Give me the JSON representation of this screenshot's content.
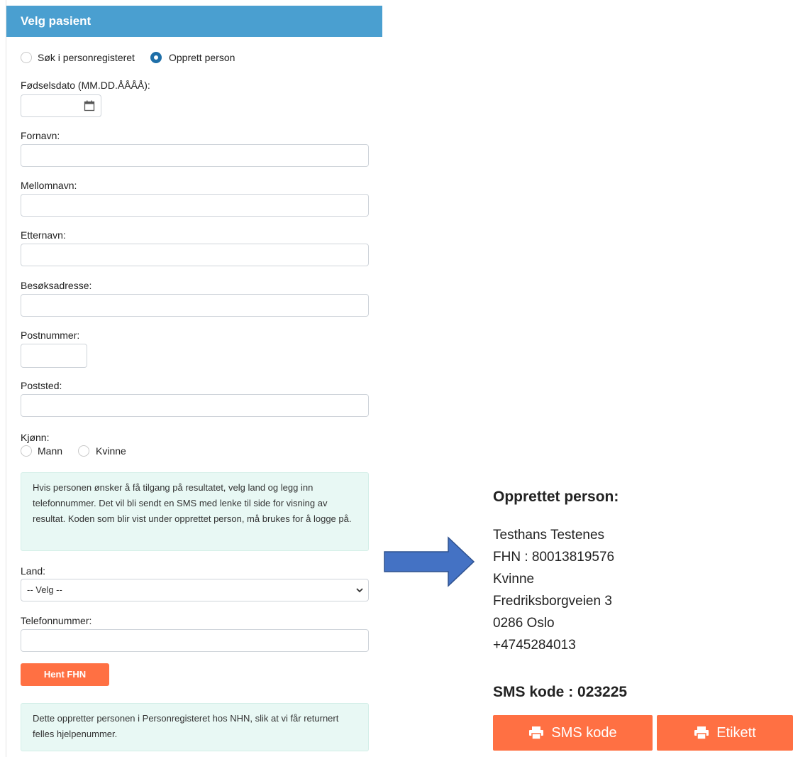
{
  "panel": {
    "title": "Velg pasient",
    "search_mode": {
      "option_search": "Søk i personregisteret",
      "option_create": "Opprett person",
      "selected": "Opprett person"
    },
    "fields": {
      "dob_label": "Fødselsdato (MM.DD.ÅÅÅÅ):",
      "first_name_label": "Fornavn:",
      "middle_name_label": "Mellomnavn:",
      "last_name_label": "Etternavn:",
      "address_label": "Besøksadresse:",
      "postal_code_label": "Postnummer:",
      "city_label": "Poststed:",
      "gender_label": "Kjønn:",
      "gender_male": "Mann",
      "gender_female": "Kvinne",
      "country_label": "Land:",
      "country_selected": "-- Velg --",
      "phone_label": "Telefonnummer:"
    },
    "info_sms": "Hvis personen ønsker å få tilgang på resultatet, velg land og legg inn telefonnummer. Det vil bli sendt en SMS med lenke til side for visning av resultat. Koden som blir vist under opprettet person, må brukes for å logge på.",
    "hent_button": "Hent FHN",
    "info_register": "Dette oppretter personen i Personregisteret hos NHN, slik at vi får returnert felles hjelpenummer."
  },
  "result": {
    "title": "Opprettet person:",
    "lines": [
      "Testhans Testenes",
      "FHN : 80013819576",
      "Kvinne",
      "Fredriksborgveien 3",
      "0286 Oslo",
      "+4745284013"
    ],
    "sms_code": "SMS kode : 023225",
    "btn_sms": "SMS kode",
    "btn_label": "Etikett"
  },
  "colors": {
    "header": "#4a9fd0",
    "accent": "#ff7043",
    "arrow": "#4472c4",
    "info_bg": "#e8f8f4"
  }
}
